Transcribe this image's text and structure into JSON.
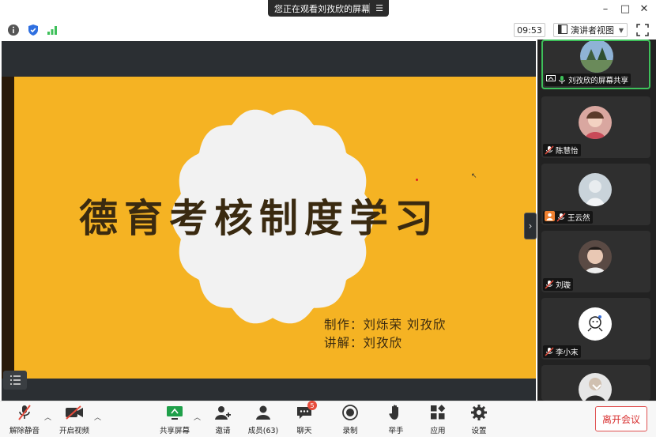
{
  "titlebar": {
    "share_banner": "您正在观看刘孜欣的屏幕",
    "controls": {
      "minimize": "–",
      "maximize": "□",
      "close": "✕"
    }
  },
  "toolbar": {
    "clock": "09:53",
    "view_mode": "演讲者视图",
    "icons": [
      "info-icon",
      "shield-icon",
      "signal-icon",
      "fullscreen-icon"
    ]
  },
  "slide": {
    "title": "德育考核制度学习",
    "credit_producers": "制作：刘烁荣  刘孜欣",
    "credit_speaker": "讲解：刘孜欣",
    "background": "#f5b323"
  },
  "participants": [
    {
      "name": "刘孜欣的屏幕共享",
      "active": true
    },
    {
      "name": "陈慧怡",
      "active": false
    },
    {
      "name": "王云然",
      "active": false
    },
    {
      "name": "刘璇",
      "active": false
    },
    {
      "name": "李小末",
      "active": false
    }
  ],
  "bottombar": {
    "unmute": "解除静音",
    "start_video": "开启视频",
    "share_screen": "共享屏幕",
    "invite": "邀请",
    "members": "成员(63)",
    "chat": "聊天",
    "chat_badge": "5",
    "record": "录制",
    "raise_hand": "举手",
    "apps": "应用",
    "settings": "设置",
    "leave": "离开会议"
  },
  "colors": {
    "accent_green": "#3ec05a",
    "leave_red": "#d83030",
    "stage_bg": "#2b2f33"
  }
}
